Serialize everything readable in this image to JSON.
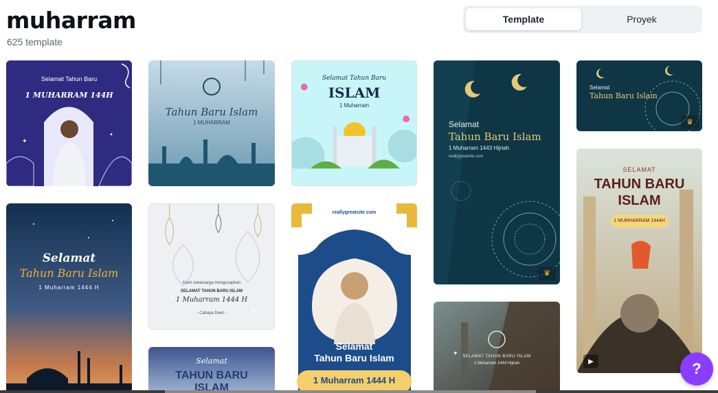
{
  "header": {
    "title": "muharram",
    "count": "625 template"
  },
  "tabs": {
    "template": "Template",
    "project": "Proyek"
  },
  "cards": {
    "c1": {
      "line1": "Selamat Tahun Baru",
      "line2": "1 MUHARRAM 144H"
    },
    "c2": {
      "line1": "Tahun Baru Islam",
      "line2": "1 MUHARRAM"
    },
    "c3": {
      "line1": "Selamat Tahun Baru",
      "line2": "ISLAM",
      "line3": "1 Muharram"
    },
    "c4": {
      "line1": "Selamat",
      "line2": "Tahun Baru Islam",
      "line3": "1 Muharram 1443 Hijriah",
      "line4": "reallygreatsite.com"
    },
    "c5": {
      "line1": "Selamat",
      "line2": "Tahun Baru Islam"
    },
    "c6": {
      "line1": "Selamat",
      "line2": "Tahun Baru Islam",
      "line3": "1 Muharram 1444 H"
    },
    "c7": {
      "line1": "Kami sekeluarga mengucapkan",
      "line2": "SELAMAT TAHUN BARU ISLAM",
      "line3": "1 Muharram 1444 H",
      "line4": "- Cahaya Dewi -"
    },
    "c8": {
      "line1": "reallygreatsite.com",
      "line2": "Selamat",
      "line3": "Tahun Baru Islam",
      "line4": "1 Muharram 1444 H"
    },
    "c9": {
      "line1": "SELAMAT TAHUN BARU ISLAM",
      "line2": "1 Muharram 1444 Hijriah"
    },
    "c10": {
      "line1": "SELAMAT",
      "line2": "TAHUN BARU",
      "line3": "ISLAM",
      "line4": "1 MURHARRAM 1444H"
    },
    "c11": {
      "line1": "Selamat",
      "line2": "TAHUN BARU",
      "line3": "ISLAM"
    }
  },
  "help": {
    "label": "?"
  },
  "colors": {
    "accent": "#8b3dff",
    "crown": "#ffc62d"
  },
  "icons": {
    "crown": "crown-icon",
    "play": "play-icon",
    "help": "question-icon"
  }
}
